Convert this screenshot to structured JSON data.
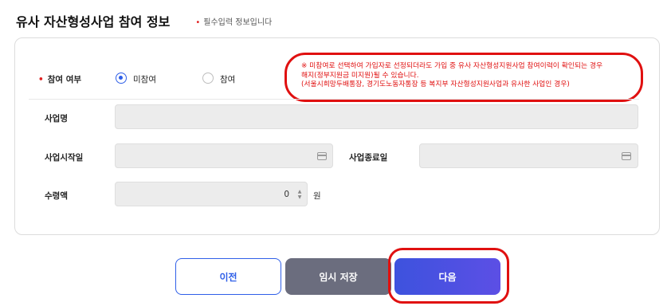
{
  "header": {
    "title": "유사 자산형성사업 참여 정보",
    "required_note": "필수입력 정보입니다"
  },
  "participation": {
    "label": "참여 여부",
    "options": [
      {
        "label": "미참여",
        "selected": true
      },
      {
        "label": "참여",
        "selected": false
      }
    ],
    "notice_lines": [
      "※ 미참여로 선택하여 가입자로 선정되더라도 가입 중 유사 자산형성지원사업 참여이력이 확인되는 경우",
      "해지(정부지원금 미지원)될 수 있습니다.",
      "(서울시희망두배통장, 경기도노동자통장 등 복지부 자산형성지원사업과 유사한 사업인 경우)"
    ]
  },
  "project": {
    "name_label": "사업명",
    "start_label": "사업시작일",
    "end_label": "사업종료일",
    "amount_label": "수령액",
    "amount_value": "0",
    "amount_unit": "원"
  },
  "buttons": {
    "prev": "이전",
    "save": "임시 저장",
    "next": "다음"
  },
  "colors": {
    "accent": "#2f5fe8",
    "required": "#e02020",
    "highlight": "#e01010",
    "save_button": "#6b6d7e"
  }
}
